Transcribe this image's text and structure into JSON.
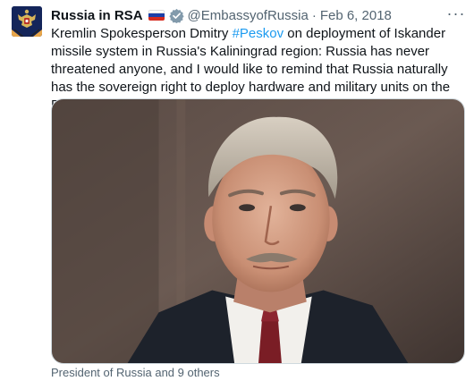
{
  "tweet": {
    "author_name": "Russia in RSA",
    "handle": "@EmbassyofRussia",
    "separator": "·",
    "date": "Feb 6, 2018",
    "more_label": "···",
    "text_before_hashtag": "Kremlin Spokesperson Dmitry ",
    "hashtag": "#Peskov",
    "text_after_hashtag": " on deployment of Iskander missile system in Russia's Kaliningrad region: Russia has never threatened anyone, and I would like to remind that Russia naturally has the sovereign right to deploy hardware and military units on the Russian territory",
    "media_caption": "President of Russia and 9 others"
  },
  "colors": {
    "hashtag": "#1d9bf0",
    "verified_badge": "#829aab",
    "secondary_text": "#536471",
    "flag_white": "#ffffff",
    "flag_blue": "#1c3fa8",
    "flag_red": "#d52b1e"
  },
  "icons": {
    "avatar": "coat-of-arms-icon",
    "flag": "russia-flag-icon",
    "verified": "verified-badge-icon",
    "more": "more-options-icon"
  }
}
